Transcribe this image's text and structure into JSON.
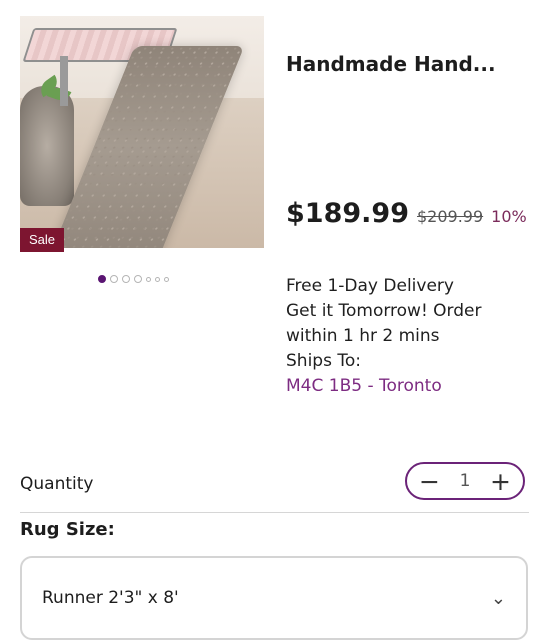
{
  "product": {
    "title": "Handmade Hand...",
    "sale_badge": "Sale",
    "price": "$189.99",
    "old_price": "$209.99",
    "discount": "10%"
  },
  "delivery": {
    "line1": "Free 1-Day Delivery",
    "line2": "Get it Tomorrow! Order",
    "line3": "within 1 hr 2 mins",
    "line4": "Ships To:",
    "postal": "M4C 1B5 - Toronto"
  },
  "quantity": {
    "label": "Quantity",
    "value": "1",
    "minus": "−",
    "plus": "+"
  },
  "rug_size": {
    "label": "Rug Size:",
    "selected": "Runner 2'3\" x 8'"
  },
  "carousel": {
    "active_index": 0,
    "count": 7
  },
  "colors": {
    "accent": "#6b2378",
    "sale": "#7d1530"
  }
}
